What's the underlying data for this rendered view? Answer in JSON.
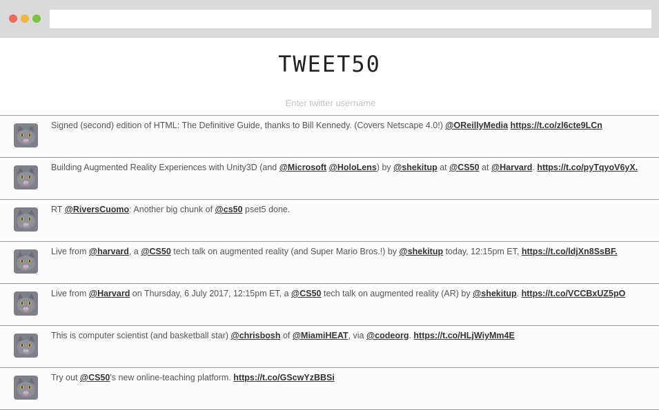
{
  "page": {
    "title": "TWEET50"
  },
  "search": {
    "placeholder": "Enter twitter username"
  },
  "tweets": [
    {
      "parts": [
        {
          "t": "text",
          "v": "Signed (second) edition of HTML: The Definitive Guide, thanks to Bill Kennedy. (Covers Netscape 4.0!) "
        },
        {
          "t": "link",
          "v": "@OReillyMedia"
        },
        {
          "t": "text",
          "v": " "
        },
        {
          "t": "link",
          "v": "https://t.co/zl6cte9LCn"
        }
      ]
    },
    {
      "parts": [
        {
          "t": "text",
          "v": "Building Augmented Reality Experiences with Unity3D (and "
        },
        {
          "t": "link",
          "v": "@Microsoft"
        },
        {
          "t": "text",
          "v": " "
        },
        {
          "t": "link",
          "v": "@HoloLens"
        },
        {
          "t": "text",
          "v": ") by "
        },
        {
          "t": "link",
          "v": "@shekitup"
        },
        {
          "t": "text",
          "v": " at "
        },
        {
          "t": "link",
          "v": "@CS50"
        },
        {
          "t": "text",
          "v": " at "
        },
        {
          "t": "link",
          "v": "@Harvard"
        },
        {
          "t": "text",
          "v": ". "
        },
        {
          "t": "link",
          "v": "https://t.co/pyTqyoV6yX."
        }
      ]
    },
    {
      "parts": [
        {
          "t": "text",
          "v": "RT "
        },
        {
          "t": "link",
          "v": "@RiversCuomo"
        },
        {
          "t": "text",
          "v": ": Another big chunk of "
        },
        {
          "t": "link",
          "v": "@cs50"
        },
        {
          "t": "text",
          "v": " pset5 done."
        }
      ]
    },
    {
      "parts": [
        {
          "t": "text",
          "v": "Live from "
        },
        {
          "t": "link",
          "v": "@harvard"
        },
        {
          "t": "text",
          "v": ", a "
        },
        {
          "t": "link",
          "v": "@CS50"
        },
        {
          "t": "text",
          "v": " tech talk on augmented reality (and Super Mario Bros.!) by "
        },
        {
          "t": "link",
          "v": "@shekitup"
        },
        {
          "t": "text",
          "v": " today, 12:15pm ET, "
        },
        {
          "t": "link",
          "v": "https://t.co/ldjXn8SsBF."
        }
      ]
    },
    {
      "parts": [
        {
          "t": "text",
          "v": "Live from "
        },
        {
          "t": "link",
          "v": "@Harvard"
        },
        {
          "t": "text",
          "v": " on Thursday, 6 July 2017, 12:15pm ET, a "
        },
        {
          "t": "link",
          "v": "@CS50"
        },
        {
          "t": "text",
          "v": " tech talk on augmented reality (AR) by "
        },
        {
          "t": "link",
          "v": "@shekitup"
        },
        {
          "t": "text",
          "v": ". "
        },
        {
          "t": "link",
          "v": "https://t.co/VCCBxUZ5pO"
        }
      ]
    },
    {
      "parts": [
        {
          "t": "text",
          "v": "This is computer scientist (and basketball star) "
        },
        {
          "t": "link",
          "v": "@chrisbosh"
        },
        {
          "t": "text",
          "v": " of "
        },
        {
          "t": "link",
          "v": "@MiamiHEAT"
        },
        {
          "t": "text",
          "v": ", via "
        },
        {
          "t": "link",
          "v": "@codeorg"
        },
        {
          "t": "text",
          "v": ". "
        },
        {
          "t": "link",
          "v": "https://t.co/HLjWiyMm4E"
        }
      ]
    },
    {
      "parts": [
        {
          "t": "text",
          "v": "Try out "
        },
        {
          "t": "link",
          "v": "@CS50"
        },
        {
          "t": "text",
          "v": "'s new online-teaching platform. "
        },
        {
          "t": "link",
          "v": "https://t.co/GScwYzBBSi"
        }
      ]
    }
  ]
}
